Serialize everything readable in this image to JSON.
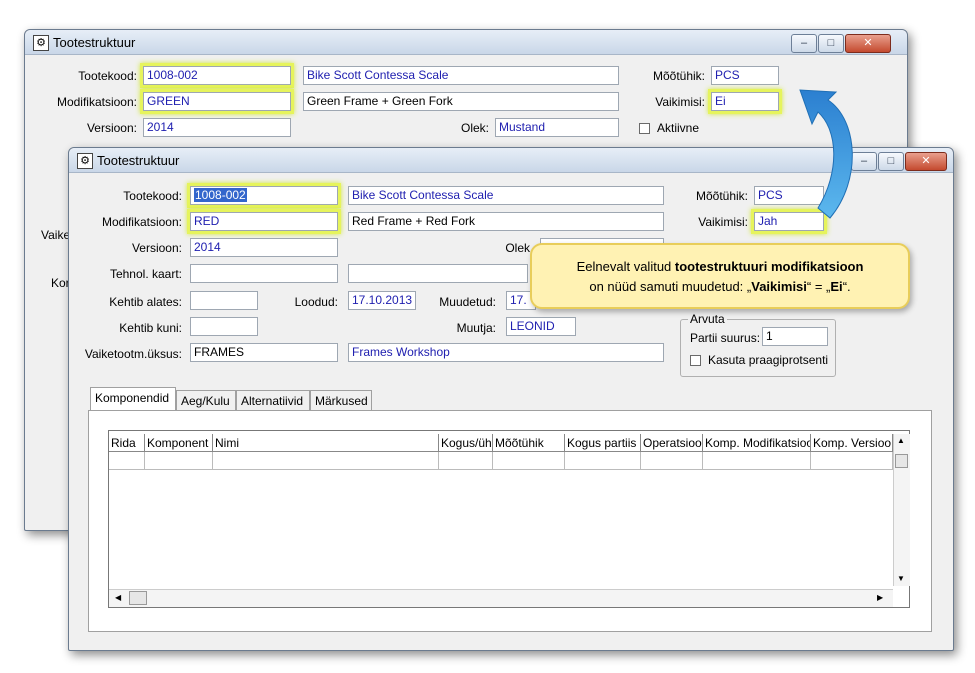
{
  "back_window": {
    "title": "Tootestruktuur",
    "tootekood_label": "Tootekood:",
    "tootekood": "1008-002",
    "tootekood_name": "Bike Scott Contessa Scale",
    "modifikatsioon_label": "Modifikatsioon:",
    "modifikatsioon": "GREEN",
    "modifikatsioon_name": "Green Frame + Green Fork",
    "versioon_label": "Versioon:",
    "versioon": "2014",
    "olek_label": "Olek:",
    "olek": "Mustand",
    "mootuhik_label": "Mõõtühik:",
    "mootuhik": "PCS",
    "vaikimisi_label": "Vaikimisi:",
    "vaikimisi": "Ei",
    "aktiivne_label": "Aktiivne",
    "left_fragment_1": "Vaike",
    "left_fragment_2": "Kor"
  },
  "front_window": {
    "title": "Tootestruktuur",
    "tootekood_label": "Tootekood:",
    "tootekood": "1008-002",
    "tootekood_name": "Bike Scott Contessa Scale",
    "modifikatsioon_label": "Modifikatsioon:",
    "modifikatsioon": "RED",
    "modifikatsioon_name": "Red Frame + Red Fork",
    "versioon_label": "Versioon:",
    "versioon": "2014",
    "olek_label": "Olek",
    "tehnol_label": "Tehnol. kaart:",
    "tehnol_value": "",
    "kehtib_alates_label": "Kehtib alates:",
    "kehtib_alates": "",
    "loodud_label": "Loodud:",
    "loodud": "17.10.2013",
    "muudetud_label": "Muudetud:",
    "muudetud": "17.",
    "kehtib_kuni_label": "Kehtib kuni:",
    "kehtib_kuni": "",
    "muutja_label": "Muutja:",
    "muutja": "LEONID",
    "vaiketootm_label": "Vaiketootm.üksus:",
    "vaiketootm": "FRAMES",
    "vaiketootm_name": "Frames Workshop",
    "mootuhik_label": "Mõõtühik:",
    "mootuhik": "PCS",
    "vaikimisi_label": "Vaikimisi:",
    "vaikimisi": "Jah",
    "arvuta_label": "Arvuta",
    "partii_suurus_label": "Partii suurus:",
    "partii_suurus": "1",
    "kasuta_label": "Kasuta praagiprotsenti",
    "tabs": [
      "Komponendid",
      "Aeg/Kulu",
      "Alternatiivid",
      "Märkused"
    ],
    "grid_columns": [
      "Rida",
      "Komponent",
      "Nimi",
      "Kogus/üh",
      "Mõõtühik",
      "Kogus partiis",
      "Operatsioo",
      "Komp. Modifikatsioo",
      "Komp. Versioo"
    ]
  },
  "callout": {
    "line1_prefix": "Eelnevalt valitud ",
    "line1_bold": "tootestruktuuri modifikatsioon",
    "line2_prefix": "on nüüd samuti muudetud: „",
    "line2_bold1": "Vaikimisi",
    "line2_mid": "“ = „",
    "line2_bold2": "Ei",
    "line2_suffix": "“."
  },
  "colors": {
    "highlight": "#e6f45c",
    "callout_bg": "#fff2b3",
    "arrow": "#3aa0e0",
    "field_text": "#2020b0"
  }
}
